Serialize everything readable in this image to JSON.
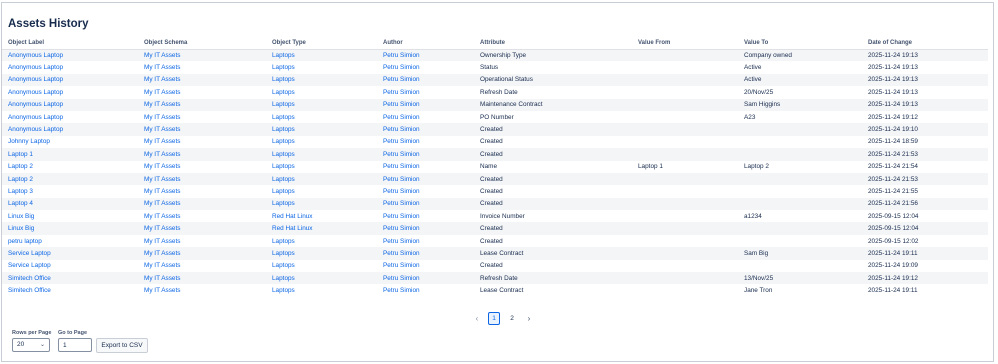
{
  "page": {
    "title": "Assets History"
  },
  "table": {
    "columns": [
      "Object Label",
      "Object Schema",
      "Object Type",
      "Author",
      "Attribute",
      "Value From",
      "Value To",
      "Date of Change"
    ],
    "rows": [
      [
        "Anonymous Laptop",
        "My IT Assets",
        "Laptops",
        "Petru Simion",
        "Ownership Type",
        "",
        "Company owned",
        "2025-11-24 19:13"
      ],
      [
        "Anonymous Laptop",
        "My IT Assets",
        "Laptops",
        "Petru Simion",
        "Status",
        "",
        "Active",
        "2025-11-24 19:13"
      ],
      [
        "Anonymous Laptop",
        "My IT Assets",
        "Laptops",
        "Petru Simion",
        "Operational Status",
        "",
        "Active",
        "2025-11-24 19:13"
      ],
      [
        "Anonymous Laptop",
        "My IT Assets",
        "Laptops",
        "Petru Simion",
        "Refresh Date",
        "",
        "20/Nov/25",
        "2025-11-24 19:13"
      ],
      [
        "Anonymous Laptop",
        "My IT Assets",
        "Laptops",
        "Petru Simion",
        "Maintenance Contract",
        "",
        "Sam Higgins",
        "2025-11-24 19:13"
      ],
      [
        "Anonymous Laptop",
        "My IT Assets",
        "Laptops",
        "Petru Simion",
        "PO Number",
        "",
        "A23",
        "2025-11-24 19:12"
      ],
      [
        "Anonymous Laptop",
        "My IT Assets",
        "Laptops",
        "Petru Simion",
        "Created",
        "",
        "",
        "2025-11-24 19:10"
      ],
      [
        "Johnny Laptop",
        "My IT Assets",
        "Laptops",
        "Petru Simion",
        "Created",
        "",
        "",
        "2025-11-24 18:59"
      ],
      [
        "Laptop 1",
        "My IT Assets",
        "Laptops",
        "Petru Simion",
        "Created",
        "",
        "",
        "2025-11-24 21:53"
      ],
      [
        "Laptop 2",
        "My IT Assets",
        "Laptops",
        "Petru Simion",
        "Name",
        "Laptop 1",
        "Laptop 2",
        "2025-11-24 21:54"
      ],
      [
        "Laptop 2",
        "My IT Assets",
        "Laptops",
        "Petru Simion",
        "Created",
        "",
        "",
        "2025-11-24 21:53"
      ],
      [
        "Laptop 3",
        "My IT Assets",
        "Laptops",
        "Petru Simion",
        "Created",
        "",
        "",
        "2025-11-24 21:55"
      ],
      [
        "Laptop 4",
        "My IT Assets",
        "Laptops",
        "Petru Simion",
        "Created",
        "",
        "",
        "2025-11-24 21:56"
      ],
      [
        "Linux Big",
        "My IT Assets",
        "Red Hat Linux",
        "Petru Simion",
        "Invoice Number",
        "",
        "a1234",
        "2025-09-15 12:04"
      ],
      [
        "Linux Big",
        "My IT Assets",
        "Red Hat Linux",
        "Petru Simion",
        "Created",
        "",
        "",
        "2025-09-15 12:04"
      ],
      [
        "petru laptop",
        "My IT Assets",
        "Laptops",
        "Petru Simion",
        "Created",
        "",
        "",
        "2025-09-15 12:02"
      ],
      [
        "Service Laptop",
        "My IT Assets",
        "Laptops",
        "Petru Simion",
        "Lease Contract",
        "",
        "Sam Big",
        "2025-11-24 19:11"
      ],
      [
        "Service Laptop",
        "My IT Assets",
        "Laptops",
        "Petru Simion",
        "Created",
        "",
        "",
        "2025-11-24 19:09"
      ],
      [
        "Simitech Office",
        "My IT Assets",
        "Laptops",
        "Petru Simion",
        "Refresh Date",
        "",
        "13/Nov/25",
        "2025-11-24 19:12"
      ],
      [
        "Simitech Office",
        "My IT Assets",
        "Laptops",
        "Petru Simion",
        "Lease Contract",
        "",
        "Jane Tron",
        "2025-11-24 19:11"
      ]
    ]
  },
  "pagination": {
    "prev_icon": "chevron-left-icon",
    "next_icon": "chevron-right-icon",
    "pages": [
      "1",
      "2"
    ],
    "current": "1"
  },
  "controls": {
    "rows_per_page_label": "Rows per Page",
    "rows_per_page_value": "20",
    "go_to_page_label": "Go to Page",
    "go_to_page_value": "1",
    "export_label": "Export to CSV"
  },
  "colors": {
    "link": "#0c66e4",
    "text": "#172b4d",
    "stripe": "#f4f5f7"
  }
}
